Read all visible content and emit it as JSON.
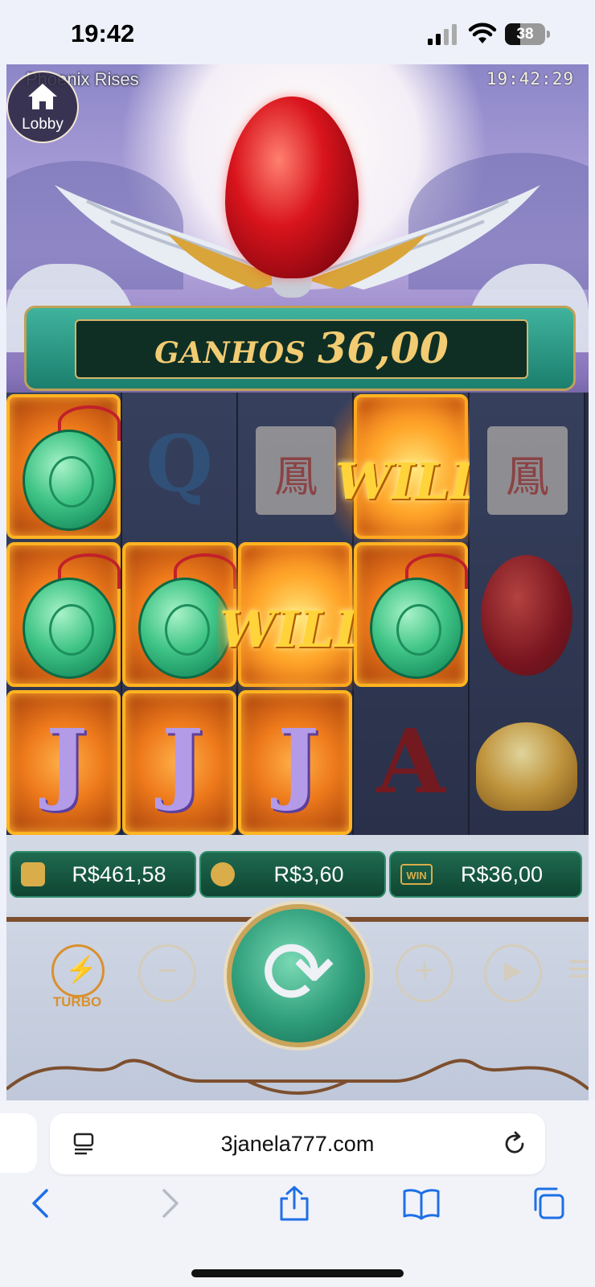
{
  "status_bar": {
    "time": "19:42",
    "battery_percent": "38",
    "battery_level": 0.38
  },
  "game": {
    "title": "Phoenix Rises",
    "clock": "19:42:29",
    "lobby_label": "Lobby",
    "win_banner": {
      "label": "GANHOS",
      "value": "36,00"
    },
    "reels": [
      [
        {
          "symbol": "jade-pendant",
          "win": true
        },
        {
          "symbol": "jade-pendant",
          "win": true
        },
        {
          "symbol": "J",
          "win": true
        }
      ],
      [
        {
          "symbol": "Q",
          "win": false
        },
        {
          "symbol": "jade-pendant",
          "win": true
        },
        {
          "symbol": "J",
          "win": true
        }
      ],
      [
        {
          "symbol": "scroll",
          "win": false
        },
        {
          "symbol": "WILD",
          "win": true
        },
        {
          "symbol": "J",
          "win": true
        }
      ],
      [
        {
          "symbol": "WILD",
          "win": true
        },
        {
          "symbol": "jade-pendant",
          "win": true
        },
        {
          "symbol": "A",
          "win": false
        }
      ],
      [
        {
          "symbol": "scroll",
          "win": false
        },
        {
          "symbol": "red-egg",
          "win": false
        },
        {
          "symbol": "gold-ingot",
          "win": false
        }
      ]
    ],
    "wild_label": "WILD",
    "scroll_char": "鳳",
    "balance": "R$461,58",
    "bet": "R$3,60",
    "win": "R$36,00",
    "win_icon_label": "WIN",
    "turbo_label": "TURBO",
    "minus_label": "−",
    "plus_label": "+"
  },
  "browser": {
    "url": "3janela777.com"
  },
  "colors": {
    "accent_gold": "#f2cc72",
    "win_green": "#1f6a50",
    "turbo_orange": "#d9902e"
  }
}
